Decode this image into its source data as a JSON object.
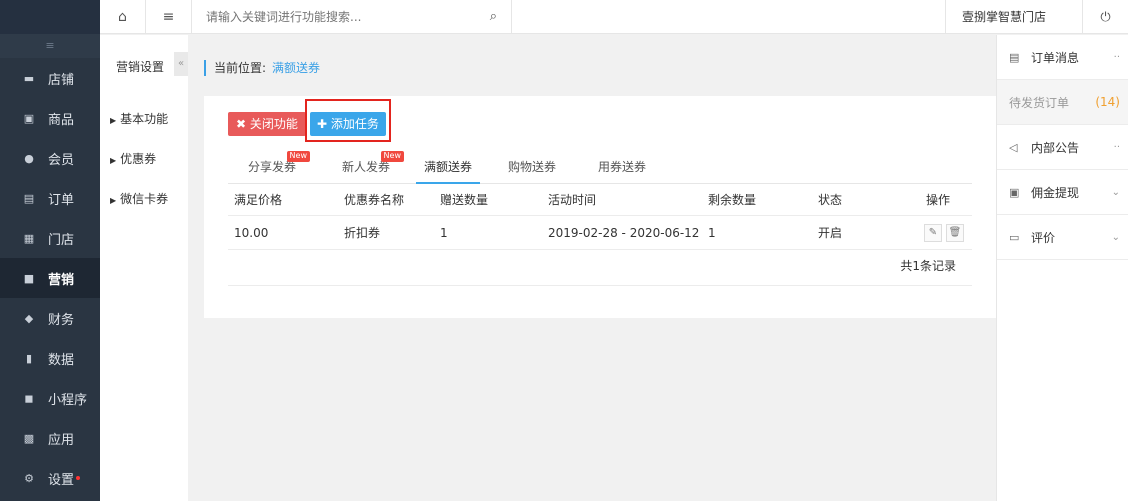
{
  "sidebar": {
    "collapse_icon": "≡",
    "items": [
      {
        "label": "店铺",
        "icon": "store-icon",
        "glyph": "▬"
      },
      {
        "label": "商品",
        "icon": "goods-icon",
        "glyph": "▣"
      },
      {
        "label": "会员",
        "icon": "member-icon",
        "glyph": "●"
      },
      {
        "label": "订单",
        "icon": "order-icon",
        "glyph": "▤"
      },
      {
        "label": "门店",
        "icon": "shop-icon",
        "glyph": "▦"
      },
      {
        "label": "营销",
        "icon": "gift-icon",
        "glyph": "■"
      },
      {
        "label": "财务",
        "icon": "money-bag-icon",
        "glyph": "◆"
      },
      {
        "label": "数据",
        "icon": "chart-icon",
        "glyph": "▮"
      },
      {
        "label": "小程序",
        "icon": "mini-program-icon",
        "glyph": "◼"
      },
      {
        "label": "应用",
        "icon": "apps-icon",
        "glyph": "▩"
      },
      {
        "label": "设置",
        "icon": "gear-icon",
        "glyph": "⚙"
      }
    ],
    "active_index": 5
  },
  "topbar": {
    "home_icon": "⌂",
    "menu_icon": "≡",
    "search_placeholder": "请输入关键词进行功能搜索...",
    "search_icon": "⌕",
    "store_name": "壹捌掌智慧门店",
    "power_icon": "⏻"
  },
  "subsidebar": {
    "title": "营销设置",
    "collapse": "«",
    "items": [
      "基本功能",
      "优惠券",
      "微信卡券"
    ]
  },
  "breadcrumb": {
    "prefix": "当前位置:",
    "current": "满额送券"
  },
  "actions": {
    "close_label": "✖ 关闭功能",
    "add_label": "✚ 添加任务"
  },
  "tabs": [
    {
      "label": "分享发券",
      "badge": "New"
    },
    {
      "label": "新人发券",
      "badge": "New"
    },
    {
      "label": "满额送券",
      "badge": ""
    },
    {
      "label": "购物送券",
      "badge": ""
    },
    {
      "label": "用券送券",
      "badge": ""
    }
  ],
  "table": {
    "headers": [
      "满足价格",
      "优惠券名称",
      "赠送数量",
      "活动时间",
      "剩余数量",
      "状态",
      "操作"
    ],
    "rows": [
      [
        "10.00",
        "折扣券",
        "1",
        "2019-02-28 - 2020-06-12",
        "1",
        "开启"
      ]
    ],
    "edit_icon": "✎",
    "delete_icon": "🗑",
    "total": "共1条记录"
  },
  "rightpanel": {
    "items": [
      {
        "label": "订单消息",
        "glyph": "▤",
        "tail": "··"
      },
      {
        "label": "待发货订单",
        "count": "(14)"
      },
      {
        "label": "内部公告",
        "glyph": "◁",
        "tail": "··"
      },
      {
        "label": "佣金提现",
        "glyph": "▣",
        "tail": "⌄"
      },
      {
        "label": "评价",
        "glyph": "▭",
        "tail": "⌄"
      }
    ]
  }
}
